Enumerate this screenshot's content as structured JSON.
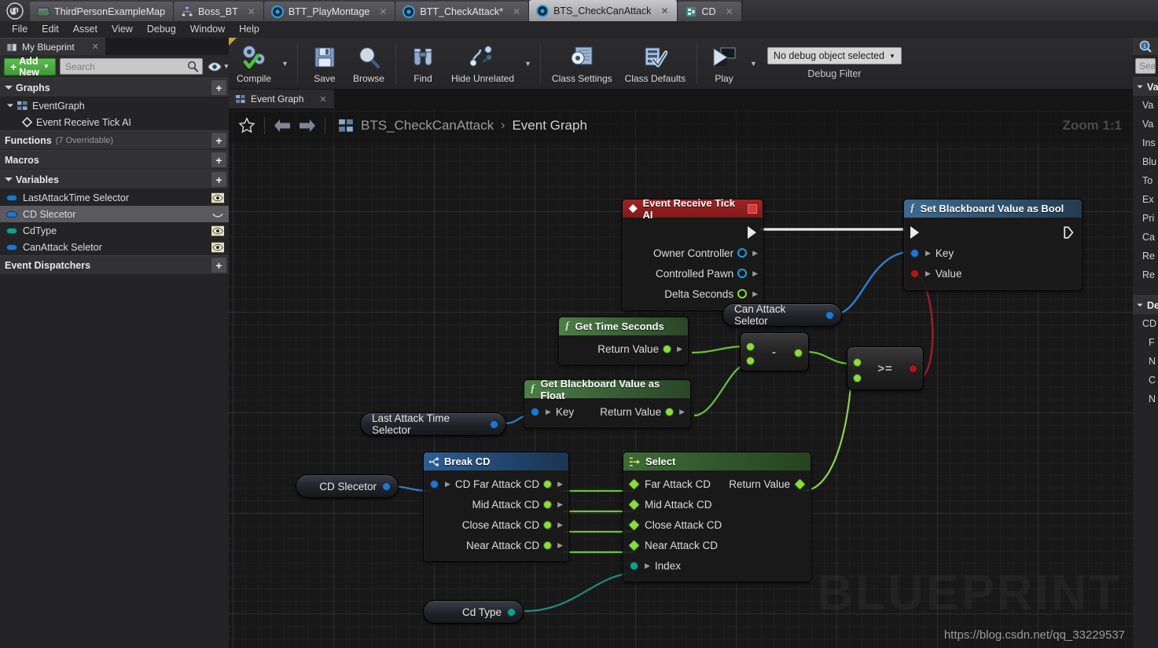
{
  "window": {
    "tabs": [
      {
        "label": "ThirdPersonExampleMap",
        "icon": "map-icon",
        "active": false,
        "closable": false
      },
      {
        "label": "Boss_BT",
        "icon": "behavior-tree-icon",
        "active": false,
        "closable": true
      },
      {
        "label": "BTT_PlayMontage",
        "icon": "blueprint-icon",
        "active": false,
        "closable": true
      },
      {
        "label": "BTT_CheckAttack*",
        "icon": "blueprint-icon",
        "active": false,
        "closable": true
      },
      {
        "label": "BTS_CheckCanAttack",
        "icon": "blueprint-icon",
        "active": true,
        "closable": true
      },
      {
        "label": "CD",
        "icon": "struct-icon",
        "active": false,
        "closable": true
      }
    ]
  },
  "menubar": {
    "items": [
      "File",
      "Edit",
      "Asset",
      "View",
      "Debug",
      "Window",
      "Help"
    ]
  },
  "toolbar": {
    "compile_label": "Compile",
    "save_label": "Save",
    "browse_label": "Browse",
    "find_label": "Find",
    "hide_unrelated_label": "Hide Unrelated",
    "class_settings_label": "Class Settings",
    "class_defaults_label": "Class Defaults",
    "play_label": "Play",
    "debug_object_value": "No debug object selected",
    "debug_filter_label": "Debug Filter"
  },
  "my_blueprint": {
    "tab_label": "My Blueprint",
    "tab_icon": "book-icon",
    "add_new_label": "Add New",
    "search_placeholder": "Search",
    "search_value": "",
    "sections": [
      {
        "title": "Graphs",
        "subtitle": "",
        "expanded": true,
        "rows": [
          {
            "label": "EventGraph",
            "icon": "graph-icon",
            "indent": 0,
            "selected": false,
            "has_eye": false,
            "expandable": true
          },
          {
            "label": "Event Receive Tick AI",
            "icon": "event-diamond-icon",
            "indent": 1,
            "selected": false,
            "has_eye": false,
            "expandable": false
          }
        ]
      },
      {
        "title": "Functions",
        "subtitle": "(7 Overridable)",
        "expanded": false,
        "rows": []
      },
      {
        "title": "Macros",
        "subtitle": "",
        "expanded": false,
        "rows": []
      },
      {
        "title": "Variables",
        "subtitle": "",
        "expanded": true,
        "rows": [
          {
            "label": "LastAttackTime Selector",
            "icon": "variable-pill",
            "color": "#1f77d0",
            "indent": 0,
            "selected": false,
            "has_eye": true,
            "eye_state": "visible"
          },
          {
            "label": "CD Slecetor",
            "icon": "variable-pill",
            "color": "#1f77d0",
            "indent": 0,
            "selected": true,
            "has_eye": true,
            "eye_state": "closed"
          },
          {
            "label": "CdType",
            "icon": "variable-pill",
            "color": "#14a08a",
            "indent": 0,
            "selected": false,
            "has_eye": true,
            "eye_state": "visible"
          },
          {
            "label": "CanAttack Seletor",
            "icon": "variable-pill",
            "color": "#1f77d0",
            "indent": 0,
            "selected": false,
            "has_eye": true,
            "eye_state": "visible"
          }
        ]
      },
      {
        "title": "Event Dispatchers",
        "subtitle": "",
        "expanded": false,
        "rows": []
      }
    ]
  },
  "graph": {
    "tab_label": "Event Graph",
    "breadcrumb": {
      "root": "BTS_CheckCanAttack",
      "separator": "›",
      "current": "Event Graph"
    },
    "zoom_label": "Zoom 1:1",
    "watermark": "BLUEPRINT",
    "blog_url": "https://blog.csdn.net/qq_33229537",
    "nodes": [
      {
        "id": "event_tick",
        "title": "Event Receive Tick AI",
        "kind": "event",
        "has_breakpoint_box": true,
        "exec_out": true,
        "outputs": [
          "Owner Controller",
          "Controlled Pawn",
          "Delta Seconds"
        ]
      },
      {
        "id": "set_bb_bool",
        "title": "Set Blackboard Value as Bool",
        "kind": "function",
        "exec_in": true,
        "exec_out": true,
        "inputs": [
          "Key",
          "Value"
        ]
      },
      {
        "id": "get_time_seconds",
        "title": "Get Time Seconds",
        "kind": "pure",
        "outputs": [
          "Return Value"
        ]
      },
      {
        "id": "get_bb_float",
        "title": "Get Blackboard Value as Float",
        "kind": "pure",
        "inputs": [
          "Key"
        ],
        "outputs": [
          "Return Value"
        ]
      },
      {
        "id": "break_cd",
        "title": "Break CD",
        "kind": "struct",
        "inputs": [
          "CD"
        ],
        "outputs": [
          "Far Attack CD",
          "Mid Attack CD",
          "Close Attack CD",
          "Near Attack CD"
        ]
      },
      {
        "id": "select",
        "title": "Select",
        "kind": "select",
        "inputs": [
          "Far Attack CD",
          "Mid Attack CD",
          "Close Attack CD",
          "Near Attack CD",
          "Index"
        ],
        "outputs": [
          "Return Value"
        ]
      },
      {
        "id": "subtract",
        "title": "-",
        "kind": "operator"
      },
      {
        "id": "greater_equal",
        "title": ">=",
        "kind": "operator"
      }
    ],
    "variable_nodes": [
      {
        "id": "can_attack_selector",
        "label": "Can Attack Seletor",
        "pin_color": "#1f77d0"
      },
      {
        "id": "last_attack_time_selector",
        "label": "Last Attack Time Selector",
        "pin_color": "#1f77d0"
      },
      {
        "id": "cd_selector",
        "label": "CD Slecetor",
        "pin_color": "#1f77d0"
      },
      {
        "id": "cd_type",
        "label": "Cd Type",
        "pin_color": "#12a08c"
      }
    ]
  },
  "right_panel": {
    "tab_icon": "details-icon",
    "search_placeholder": "Sea",
    "sections": [
      {
        "title": "Va",
        "rows": [
          "Va",
          "Va",
          "Ins",
          "Blu",
          "To",
          "Ex",
          "Pri",
          "Ca",
          "Re",
          "Re"
        ]
      },
      {
        "title": "De",
        "rows": [
          "CD",
          "F",
          "N",
          "C",
          "N"
        ]
      }
    ]
  },
  "colors": {
    "accent_green": "#4fb845",
    "exec_white": "#e9e9e9",
    "bool_red": "#a81b1b",
    "object_blue": "#1f9ddb",
    "float_green": "#8cdb3f",
    "name_blue": "#1f77d0",
    "struct_blue": "#2d5d93",
    "byte_teal": "#12a08c"
  }
}
